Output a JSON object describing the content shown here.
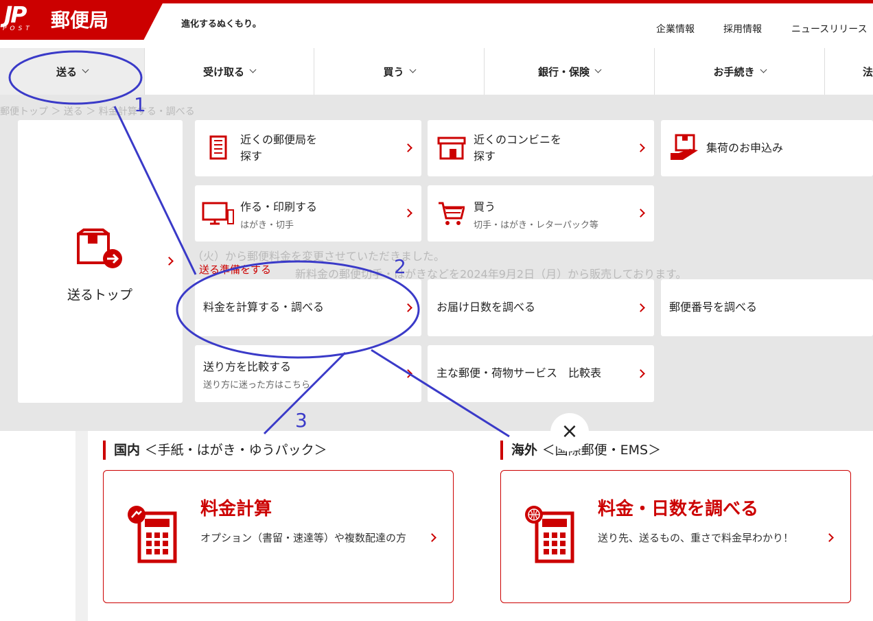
{
  "header": {
    "logo_mark": "JP",
    "logo_sub": "POST",
    "logo_name": "郵便局",
    "tagline": "進化するぬくもり。",
    "links": [
      "企業情報",
      "採用情報",
      "ニュースリリース"
    ]
  },
  "nav": {
    "items": [
      "送る",
      "受け取る",
      "買う",
      "銀行・保険",
      "お手続き",
      "法"
    ]
  },
  "background": {
    "breadcrumb": "郵便トップ ＞ 送る ＞ 料金計算する・調べる",
    "notice1": "（火）から郵便料金を変更させていただきました。",
    "notice2": "新料金の郵便切手・はがきなどを2024年9月2日（月）から販売しております。"
  },
  "mega_menu": {
    "top_label": "送るトップ",
    "cards": [
      {
        "title": "近くの郵便局を\n探す",
        "icon": "post-office-building-icon"
      },
      {
        "title": "近くのコンビニを\n探す",
        "icon": "convenience-store-icon"
      },
      {
        "title": "集荷のお申込み",
        "icon": "pickup-hand-icon"
      },
      {
        "title": "作る・印刷する",
        "sub": "はがき・切手",
        "icon": "computer-icon"
      },
      {
        "title": "買う",
        "sub": "切手・はがき・レターパック等",
        "icon": "shopping-cart-icon"
      }
    ],
    "prep_label": "送る準備をする",
    "prep_cards": [
      {
        "title": "料金を計算する・調べる"
      },
      {
        "title": "お届け日数を調べる"
      },
      {
        "title": "郵便番号を調べる"
      },
      {
        "title": "送り方を比較する",
        "sub": "送り方に迷った方はこちら"
      },
      {
        "title": "主な郵便・荷物サービス　比較表"
      }
    ],
    "close": "×"
  },
  "domestic": {
    "heading": "国内",
    "heading_sub": "＜手紙・はがき・ゆうパック＞",
    "card_title": "料金計算",
    "card_desc": "オプション（書留・速達等）や複数配達の方"
  },
  "international": {
    "heading": "海外",
    "heading_sub": "＜国際郵便・EMS＞",
    "card_title": "料金・日数を調べる",
    "card_desc": "送り先、送るもの、重さで料金早わかり！"
  },
  "annotations": [
    "1",
    "2",
    "3"
  ],
  "colors": {
    "brand": "#cc0000",
    "annotation": "#3a3ac8",
    "overlay": "#e6e6e6"
  }
}
